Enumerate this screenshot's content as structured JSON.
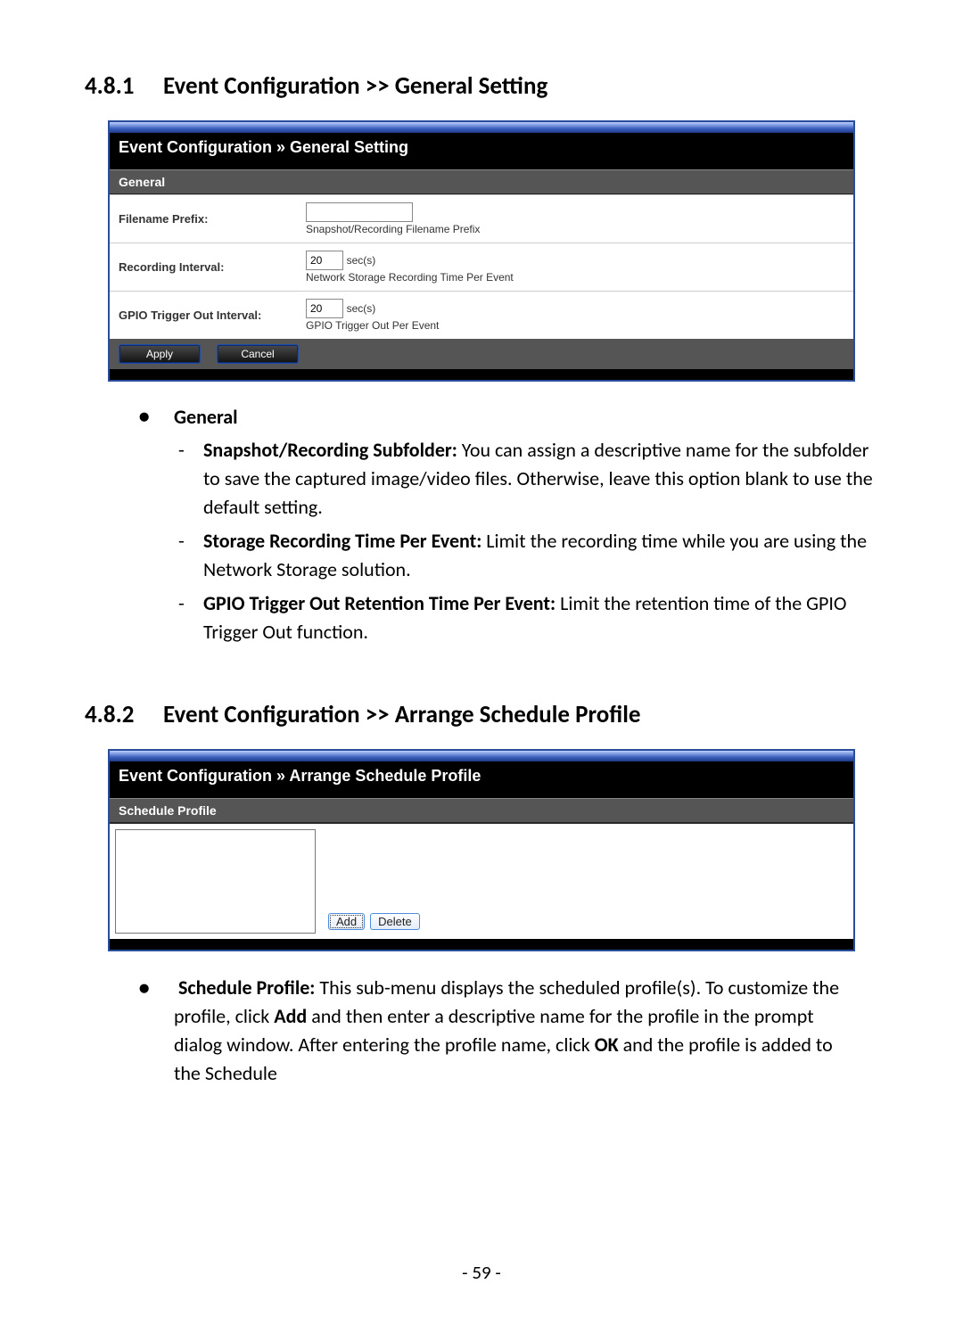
{
  "section1": {
    "number": "4.8.1",
    "title": "Event Configuration >> General Setting"
  },
  "panel1": {
    "breadcrumb": "Event Configuration » General Setting",
    "band": "General",
    "rows": {
      "r1": {
        "label": "Filename Prefix:",
        "value": "",
        "hint": "Snapshot/Recording Filename Prefix"
      },
      "r2": {
        "label": "Recording Interval:",
        "value": "20",
        "unit": "sec(s)",
        "hint": "Network Storage Recording Time Per Event"
      },
      "r3": {
        "label": "GPIO Trigger Out Interval:",
        "value": "20",
        "unit": "sec(s)",
        "hint": "GPIO Trigger Out Per Event"
      }
    },
    "apply": "Apply",
    "cancel": "Cancel"
  },
  "bullets1": {
    "head": "General",
    "i1": {
      "bold": "Snapshot/Recording Subfolder:",
      "rest": " You can assign a descriptive name for the subfolder to save the captured image/video files. Otherwise, leave this option blank to use the default setting."
    },
    "i2": {
      "bold": "Storage Recording Time Per Event:",
      "rest": " Limit the recording time while you are using the Network Storage solution."
    },
    "i3": {
      "bold": "GPIO Trigger Out Retention Time Per Event:",
      "rest": " Limit the retention time of the GPIO Trigger Out function."
    }
  },
  "section2": {
    "number": "4.8.2",
    "title": "Event Configuration >> Arrange Schedule Profile"
  },
  "panel2": {
    "breadcrumb": "Event Configuration » Arrange Schedule Profile",
    "band": "Schedule Profile",
    "add": "Add",
    "delete": "Delete"
  },
  "para2": {
    "bold1": "Schedule Profile:",
    "t1": " This sub-menu displays the scheduled profile(s). To customize the profile, click ",
    "bold2": "Add",
    "t2": " and then enter a descriptive name for the profile in the prompt dialog window. After entering the profile name, click ",
    "bold3": "OK",
    "t3": " and the profile is added to the Schedule"
  },
  "pageNumber": "- 59 -"
}
